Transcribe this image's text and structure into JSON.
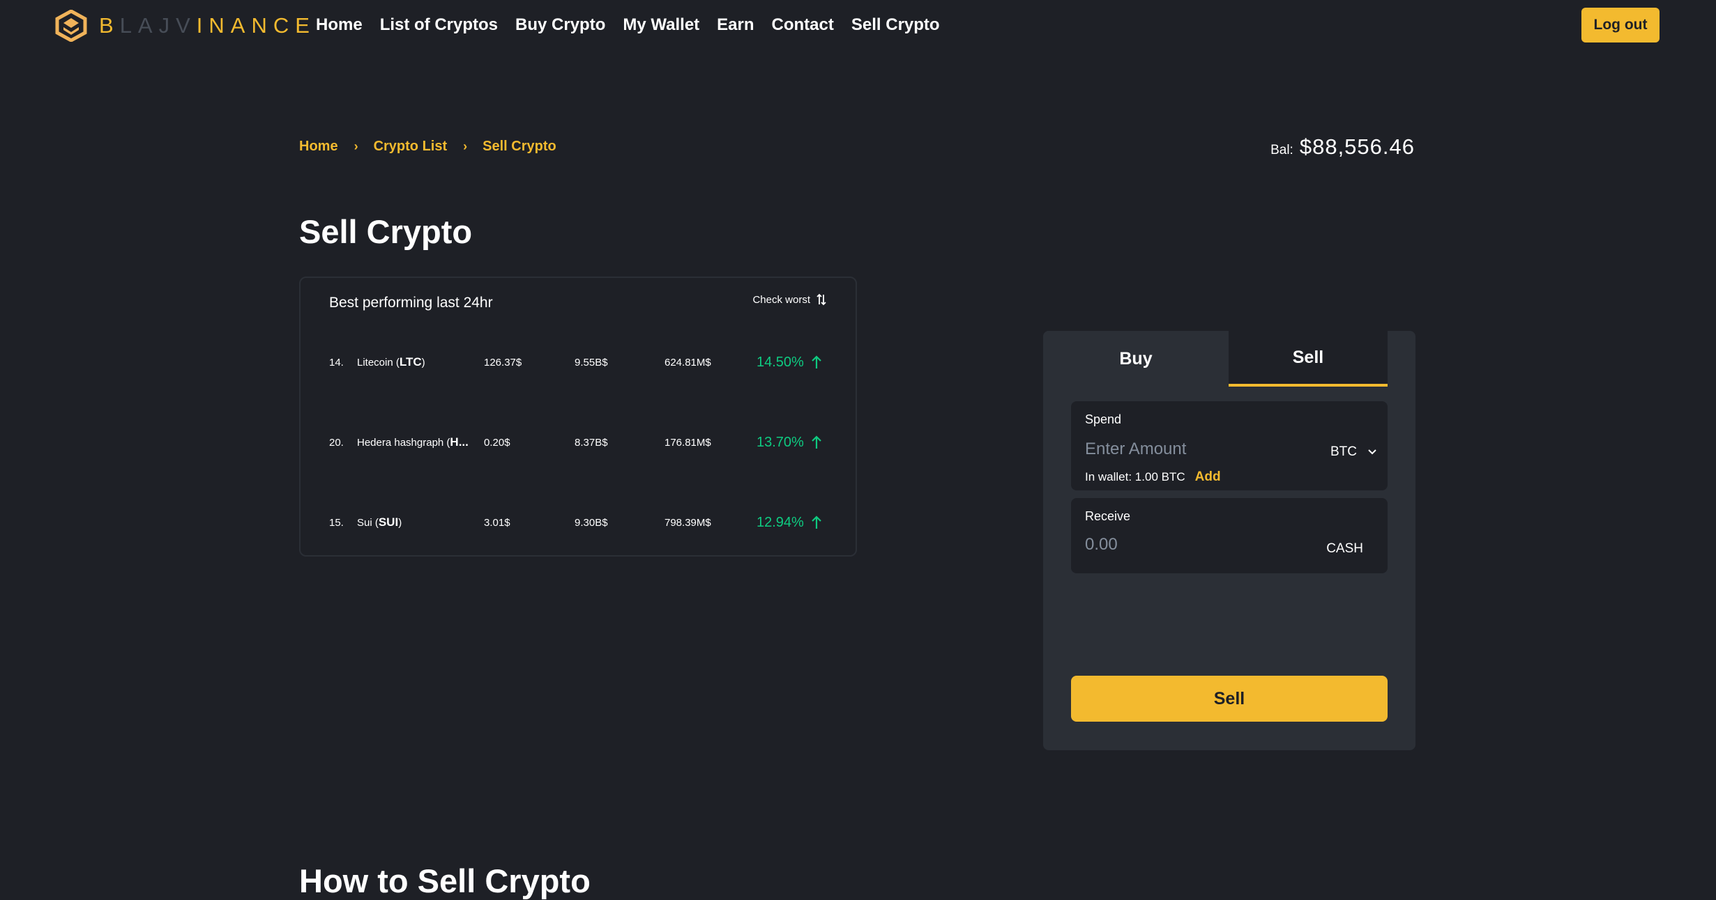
{
  "brand": {
    "letters_gold_1": "B",
    "letters_dark": "LAJV",
    "letters_gold_2": "INANCE"
  },
  "nav": {
    "items": [
      {
        "label": "Home"
      },
      {
        "label": "List of Cryptos"
      },
      {
        "label": "Buy Crypto"
      },
      {
        "label": "My Wallet"
      },
      {
        "label": "Earn"
      },
      {
        "label": "Contact"
      },
      {
        "label": "Sell Crypto"
      }
    ],
    "logout_label": "Log out"
  },
  "breadcrumb": [
    "Home",
    "Crypto List",
    "Sell Crypto"
  ],
  "balance": {
    "label": "Bal:",
    "value": "$88,556.46"
  },
  "page_title": "Sell Crypto",
  "performance": {
    "title": "Best performing last 24hr",
    "toggle_label": "Check worst",
    "rows": [
      {
        "rank": "14.",
        "name": "Litecoin (",
        "symbol": "LTC",
        "close": ")",
        "price": "126.37$",
        "market_cap": "9.55B$",
        "volume": "624.81M$",
        "change": "14.50%"
      },
      {
        "rank": "20.",
        "name": "Hedera hashgraph (",
        "symbol": "H...",
        "close": "",
        "price": "0.20$",
        "market_cap": "8.37B$",
        "volume": "176.81M$",
        "change": "13.70%"
      },
      {
        "rank": "15.",
        "name": "Sui (",
        "symbol": "SUI",
        "close": ")",
        "price": "3.01$",
        "market_cap": "9.30B$",
        "volume": "798.39M$",
        "change": "12.94%"
      }
    ]
  },
  "trade": {
    "tabs": [
      {
        "label": "Buy"
      },
      {
        "label": "Sell"
      }
    ],
    "active_tab": "Sell",
    "spend": {
      "label": "Spend",
      "placeholder": "Enter Amount",
      "currency": "BTC",
      "wallet_text": "In wallet: 1.00 BTC",
      "add_label": "Add"
    },
    "receive": {
      "label": "Receive",
      "placeholder": "0.00",
      "currency": "CASH"
    },
    "submit_label": "Sell"
  },
  "howto_title": "How to Sell Crypto",
  "colors": {
    "background": "#1e2026",
    "panel": "#2b2f36",
    "accent": "#f3ba2f",
    "positive": "#0ecb81"
  }
}
